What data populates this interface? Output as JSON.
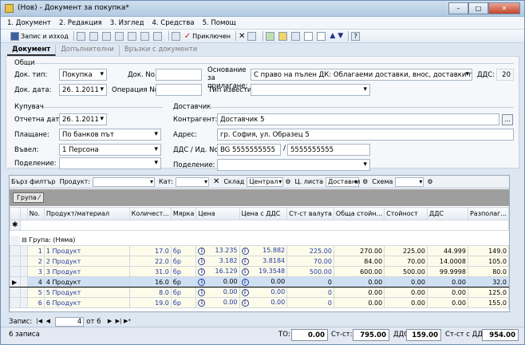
{
  "window": {
    "title": "(Нов) - Документ за покупка*",
    "min": "–",
    "max": "□",
    "close": "✕"
  },
  "menu": [
    "1. Документ",
    "2. Редакция",
    "3. Изглед",
    "4. Средства",
    "5. Помощ"
  ],
  "toolbar": {
    "save": "Запис и изход",
    "accept": "Приключен"
  },
  "tabs": [
    "Документ",
    "Допълнителни",
    "Връзки с документи"
  ],
  "general": {
    "heading": "Общи",
    "doc_type_label": "Док. тип:",
    "doc_type": "Покупка",
    "doc_no_label": "Док. No.",
    "doc_no": "",
    "doc_date_label": "Док. дата:",
    "doc_date": "26.  1.2011",
    "operation_label": "Операция No.",
    "operation": "",
    "basis_label": "Основание за прилагане:",
    "basis": "С право на пълен ДК: Облагаеми доставки, внос, доставки по чл.69, ал.2",
    "vat_label": "ДДС:",
    "vat": "20",
    "notice_label": "Тип известие:",
    "notice": ""
  },
  "buyer": {
    "heading": "Купувач",
    "report_date_label": "Отчетна дата:",
    "report_date": "26.  1.2011",
    "payment_label": "Плащане:",
    "payment": "По банков път",
    "entered_label": "Въвел:",
    "entered": "1 Персона",
    "division_label": "Поделение:",
    "division": ""
  },
  "supplier": {
    "heading": "Доставчик",
    "contractor_label": "Контрагент:",
    "contractor": "Доставчик 5",
    "address_label": "Адрес:",
    "address": "гр. София, ул. Образец 5",
    "vat_id_label": "ДДС / Ид. No.",
    "vat_no": "BG 5555555555",
    "id_no": "5555555555",
    "division_label": "Поделение:",
    "division": ""
  },
  "filter": {
    "quick": "Бърз филтър",
    "product_label": "Продукт:",
    "category_label": "Кат:",
    "warehouse_label": "Склад",
    "warehouse": "Централ",
    "pricelist_label": "Ц. листа",
    "pricelist": "Доставни",
    "scheme_label": "Схема"
  },
  "groupchip": "Група",
  "grid": {
    "headers": [
      "",
      "No.",
      "Продукт/материал",
      "Количест...",
      "Мярка",
      "Цена",
      "Цена с ДДС",
      "Ст-ст валута",
      "Обща стойн...",
      "Стойност",
      "ДДС",
      "Разполаг..."
    ],
    "group_row": "Група: (Няма)",
    "rows": [
      {
        "no": "1",
        "product": "1 Продукт",
        "qty": "17.0",
        "unit": "бр",
        "price": "13.235",
        "price_vat": "15.882",
        "cur": "225.00",
        "total": "270.00",
        "value": "225.00",
        "vat": "44.999",
        "avail": "149.0"
      },
      {
        "no": "2",
        "product": "2 Продукт",
        "qty": "22.0",
        "unit": "бр",
        "price": "3.182",
        "price_vat": "3.8184",
        "cur": "70.00",
        "total": "84.00",
        "value": "70.00",
        "vat": "14.0008",
        "avail": "105.0"
      },
      {
        "no": "3",
        "product": "3 Продукт",
        "qty": "31.0",
        "unit": "бр",
        "price": "16.129",
        "price_vat": "19.3548",
        "cur": "500.00",
        "total": "600.00",
        "value": "500.00",
        "vat": "99.9998",
        "avail": "80.0"
      },
      {
        "no": "4",
        "product": "4 Продукт",
        "qty": "16.0",
        "unit": "бр",
        "price": "0.00",
        "price_vat": "0.00",
        "cur": "0",
        "total": "0.00",
        "value": "0.00",
        "vat": "0.00",
        "avail": "32.0"
      },
      {
        "no": "5",
        "product": "5 Продукт",
        "qty": "8.0",
        "unit": "бр",
        "price": "0.00",
        "price_vat": "0.00",
        "cur": "0",
        "total": "0.00",
        "value": "0.00",
        "vat": "0.00",
        "avail": "125.0"
      },
      {
        "no": "6",
        "product": "6 Продукт",
        "qty": "19.0",
        "unit": "бр",
        "price": "0.00",
        "price_vat": "0.00",
        "cur": "0",
        "total": "0.00",
        "value": "0.00",
        "vat": "0.00",
        "avail": "155.0"
      }
    ]
  },
  "nav": {
    "label": "Запис:",
    "current": "4",
    "of": "от 6"
  },
  "status": {
    "records": "6 записа",
    "to_label": "ТО:",
    "to": "0.00",
    "cost_label": "Ст-ст:",
    "cost": "795.00",
    "vat_label": "ДДС:",
    "vat": "159.00",
    "cost_vat_label": "Ст-ст с ДДС:",
    "cost_vat": "954.00"
  }
}
